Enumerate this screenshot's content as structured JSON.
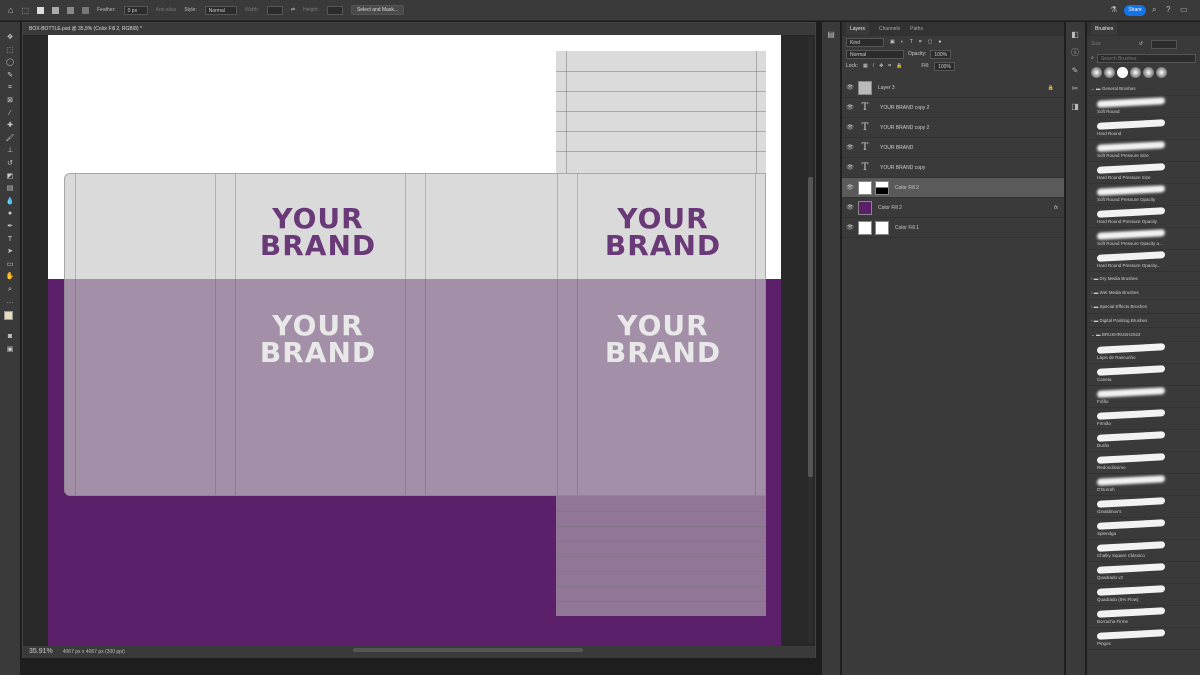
{
  "options_bar": {
    "feather_label": "Feather:",
    "feather_value": "0 px",
    "antialias": "Anti-alias",
    "style_label": "Style:",
    "style_value": "Normal",
    "width_label": "Width:",
    "height_label": "Height:",
    "select_mask": "Select and Mask...",
    "share": "Share"
  },
  "document": {
    "tab_title": "BOX-BOTTLE.psd @ 35,9% (Color Fill 2, RGB/8) *",
    "zoom": "35.91%",
    "dimensions": "4067 px x 4067 px (300 ppi)",
    "brand_line1": "YOUR",
    "brand_line2": "BRAND",
    "colors": {
      "purple": "#5c1f6a",
      "brand_text": "#6a3a78"
    }
  },
  "layers_panel": {
    "tabs": [
      "Layers",
      "Channels",
      "Paths"
    ],
    "filter": "Kind",
    "blend_mode": "Normal",
    "opacity_label": "Opacity:",
    "opacity": "100%",
    "lock_label": "Lock:",
    "fill_label": "Fill:",
    "fill": "100%",
    "layers": [
      {
        "name": "Layer 3",
        "type": "image",
        "locked": true
      },
      {
        "name": "YOUR BRAND copy 2",
        "type": "text"
      },
      {
        "name": "YOUR BRAND copy 2",
        "type": "text"
      },
      {
        "name": "YOUR BRAND",
        "type": "text"
      },
      {
        "name": "YOUR BRAND copy",
        "type": "text"
      },
      {
        "name": "Color Fill 2",
        "type": "fill-mask",
        "selected": true
      },
      {
        "name": "Color Fill 2",
        "type": "fill-purple",
        "fx": "fx"
      },
      {
        "name": "Color Fill 1",
        "type": "fill-mask-white"
      }
    ]
  },
  "brushes_panel": {
    "title": "Brushes",
    "size_label": "Size",
    "search_placeholder": "Search Brushes",
    "general_folder": "General Brushes",
    "general": [
      {
        "name": "Soft Round",
        "soft": true
      },
      {
        "name": "Hard Round"
      },
      {
        "name": "Soft Round Pressure Size",
        "soft": true
      },
      {
        "name": "Hard Round Pressure Size"
      },
      {
        "name": "Soft Round Pressure Opacity",
        "soft": true
      },
      {
        "name": "Hard Round Pressure Opacity"
      },
      {
        "name": "Soft Round Pressure Opacity a...",
        "soft": true
      },
      {
        "name": "Hard Round Pressure Opacity..."
      }
    ],
    "folders": [
      "Dry Media Brushes",
      "Wet Media Brushes",
      "Special Effects Brushes",
      "Digital Painting Brushes"
    ],
    "custom_folder": "BRUSHRUSH2023",
    "custom": [
      {
        "name": "Lápis de Rascunho"
      },
      {
        "name": "Caneta"
      },
      {
        "name": "Fofão",
        "soft": true
      },
      {
        "name": "Firmão"
      },
      {
        "name": "Durão"
      },
      {
        "name": "Redondissimo"
      },
      {
        "name": "D'Borrah",
        "soft": true
      },
      {
        "name": "Ginaldinov's"
      },
      {
        "name": "Splendga"
      },
      {
        "name": "Chalky Square Clássico"
      },
      {
        "name": "Quadrado v2"
      },
      {
        "name": "Quadrado (5% Flow)"
      },
      {
        "name": "Borracha Firme"
      },
      {
        "name": "Pingos"
      }
    ]
  }
}
